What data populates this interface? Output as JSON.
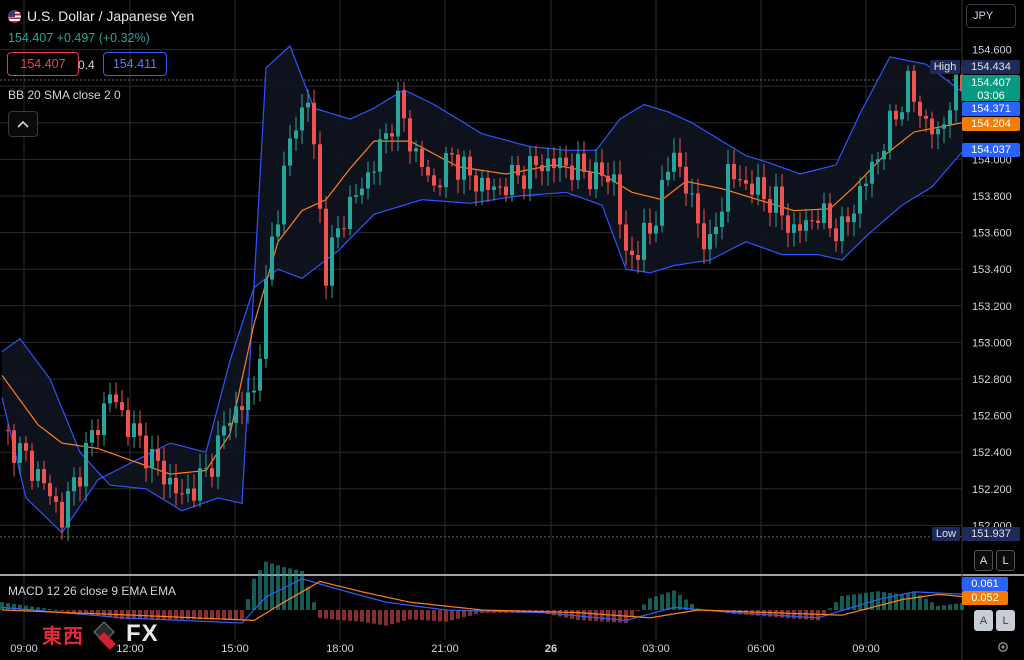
{
  "header": {
    "symbol": "U.S. Dollar / Japanese Yen",
    "change": "154.407 +0.497 (+0.32%)",
    "sell_price": "154.407",
    "spread": "0.4",
    "buy_price": "154.411",
    "indicator_label": "BB 20 SMA close 2 0",
    "collapse_icon": "chevron-up-icon"
  },
  "currency_select": "JPY",
  "axis": {
    "price_ticks": [
      "154.600",
      "154.400",
      "154.200",
      "154.000",
      "153.800",
      "153.600",
      "153.400",
      "153.200",
      "153.000",
      "152.800",
      "152.600",
      "152.400",
      "152.200",
      "152.000"
    ],
    "time_ticks": [
      "09:00",
      "12:00",
      "15:00",
      "18:00",
      "21:00",
      "26",
      "03:00",
      "06:00",
      "09:00"
    ],
    "high_label": "High",
    "high_value": "154.434",
    "low_label": "Low",
    "low_value": "151.937",
    "last_price": "154.407",
    "countdown": "03:06",
    "bb_upper": "154.371",
    "bb_basis": "154.204",
    "bb_lower": "154.037",
    "btn_auto": "A",
    "btn_log": "L"
  },
  "macd": {
    "label": "MACD 12 26 close 9 EMA EMA",
    "macd_value": "0.061",
    "signal_value": "0.052"
  },
  "watermark": {
    "kanji": "東西",
    "fx": "FX"
  },
  "colors": {
    "up": "#26a69a",
    "down": "#ef5350",
    "bb_band": "#2f53ff",
    "bb_basis": "#ff7f1e",
    "high_box": "#1e2a5a",
    "last_price_box": "#089981",
    "upper_box": "#2962ff",
    "basis_box": "#f57c00"
  },
  "chart_data": {
    "type": "candlestick",
    "symbol": "U.S. Dollar / Japanese Yen",
    "close_anchors": [
      [
        0,
        152.52
      ],
      [
        6,
        152.28
      ],
      [
        10,
        152.05
      ],
      [
        14,
        152.4
      ],
      [
        18,
        152.72
      ],
      [
        22,
        152.5
      ],
      [
        26,
        152.32
      ],
      [
        30,
        152.15
      ],
      [
        34,
        152.28
      ],
      [
        38,
        152.6
      ],
      [
        42,
        152.72
      ],
      [
        45,
        153.55
      ],
      [
        48,
        154.1
      ],
      [
        51,
        154.35
      ],
      [
        54,
        153.4
      ],
      [
        57,
        153.7
      ],
      [
        60,
        153.85
      ],
      [
        63,
        154.05
      ],
      [
        66,
        154.3
      ],
      [
        69,
        154.02
      ],
      [
        72,
        153.85
      ],
      [
        75,
        154.02
      ],
      [
        78,
        153.9
      ],
      [
        82,
        153.83
      ],
      [
        86,
        153.91
      ],
      [
        90,
        153.98
      ],
      [
        94,
        153.97
      ],
      [
        98,
        153.92
      ],
      [
        102,
        153.9
      ],
      [
        104,
        153.45
      ],
      [
        108,
        153.6
      ],
      [
        112,
        154.05
      ],
      [
        115,
        153.75
      ],
      [
        118,
        153.5
      ],
      [
        121,
        153.92
      ],
      [
        125,
        153.85
      ],
      [
        129,
        153.76
      ],
      [
        132,
        153.6
      ],
      [
        136,
        153.7
      ],
      [
        140,
        153.6
      ],
      [
        143,
        153.82
      ],
      [
        146,
        154.02
      ],
      [
        149,
        154.25
      ],
      [
        151,
        154.4
      ],
      [
        154,
        154.2
      ],
      [
        156,
        154.12
      ],
      [
        158,
        154.32
      ],
      [
        160,
        154.41
      ]
    ],
    "bb_upper_anchors": [
      [
        0,
        152.95
      ],
      [
        3,
        153.02
      ],
      [
        8,
        152.8
      ],
      [
        13,
        152.4
      ],
      [
        18,
        152.22
      ],
      [
        24,
        152.2
      ],
      [
        30,
        152.08
      ],
      [
        36,
        152.15
      ],
      [
        40,
        152.12
      ],
      [
        44,
        154.5
      ],
      [
        48,
        154.62
      ],
      [
        52,
        154.28
      ],
      [
        58,
        154.22
      ],
      [
        62,
        154.28
      ],
      [
        67,
        154.38
      ],
      [
        72,
        154.3
      ],
      [
        80,
        154.14
      ],
      [
        88,
        154.07
      ],
      [
        94,
        154.05
      ],
      [
        99,
        154.05
      ],
      [
        103,
        154.22
      ],
      [
        107,
        154.3
      ],
      [
        111,
        154.26
      ],
      [
        115,
        154.2
      ],
      [
        119,
        154.12
      ],
      [
        124,
        154.02
      ],
      [
        128,
        153.98
      ],
      [
        133,
        153.92
      ],
      [
        139,
        153.97
      ],
      [
        143,
        154.25
      ],
      [
        148,
        154.56
      ],
      [
        154,
        154.52
      ],
      [
        160,
        154.37
      ]
    ],
    "bb_basis_anchors": [
      [
        0,
        152.82
      ],
      [
        6,
        152.55
      ],
      [
        10,
        152.45
      ],
      [
        16,
        152.42
      ],
      [
        22,
        152.35
      ],
      [
        28,
        152.28
      ],
      [
        34,
        152.3
      ],
      [
        38,
        152.5
      ],
      [
        42,
        153.1
      ],
      [
        46,
        153.55
      ],
      [
        50,
        153.72
      ],
      [
        54,
        153.78
      ],
      [
        58,
        153.95
      ],
      [
        62,
        154.1
      ],
      [
        68,
        154.1
      ],
      [
        76,
        153.96
      ],
      [
        84,
        153.92
      ],
      [
        92,
        153.97
      ],
      [
        100,
        153.92
      ],
      [
        105,
        153.82
      ],
      [
        110,
        153.78
      ],
      [
        114,
        153.88
      ],
      [
        120,
        153.84
      ],
      [
        126,
        153.78
      ],
      [
        132,
        153.72
      ],
      [
        138,
        153.73
      ],
      [
        142,
        153.85
      ],
      [
        147,
        154.02
      ],
      [
        152,
        154.15
      ],
      [
        160,
        154.2
      ]
    ],
    "bb_lower_anchors": [
      [
        0,
        152.7
      ],
      [
        4,
        152.15
      ],
      [
        10,
        151.96
      ],
      [
        16,
        152.25
      ],
      [
        22,
        152.35
      ],
      [
        28,
        152.45
      ],
      [
        34,
        152.4
      ],
      [
        38,
        152.9
      ],
      [
        42,
        153.3
      ],
      [
        46,
        153.4
      ],
      [
        50,
        153.35
      ],
      [
        56,
        153.5
      ],
      [
        62,
        153.7
      ],
      [
        70,
        153.78
      ],
      [
        78,
        153.76
      ],
      [
        86,
        153.8
      ],
      [
        94,
        153.82
      ],
      [
        100,
        153.75
      ],
      [
        104,
        153.4
      ],
      [
        108,
        153.38
      ],
      [
        112,
        153.42
      ],
      [
        118,
        153.45
      ],
      [
        124,
        153.55
      ],
      [
        130,
        153.48
      ],
      [
        136,
        153.48
      ],
      [
        140,
        153.45
      ],
      [
        144,
        153.58
      ],
      [
        150,
        153.75
      ],
      [
        155,
        153.85
      ],
      [
        160,
        154.04
      ]
    ],
    "macd_anchors": [
      [
        0,
        0.01
      ],
      [
        20,
        -0.03
      ],
      [
        40,
        -0.05
      ],
      [
        44,
        0.05
      ],
      [
        50,
        0.12
      ],
      [
        56,
        0.08
      ],
      [
        64,
        0.03
      ],
      [
        74,
        0.0
      ],
      [
        90,
        -0.01
      ],
      [
        104,
        -0.04
      ],
      [
        112,
        0.01
      ],
      [
        122,
        -0.01
      ],
      [
        136,
        -0.03
      ],
      [
        146,
        0.04
      ],
      [
        152,
        0.07
      ],
      [
        160,
        0.061
      ]
    ],
    "signal_anchors": [
      [
        0,
        0.0
      ],
      [
        22,
        -0.02
      ],
      [
        42,
        -0.04
      ],
      [
        47,
        0.03
      ],
      [
        53,
        0.11
      ],
      [
        60,
        0.07
      ],
      [
        68,
        0.03
      ],
      [
        80,
        0.0
      ],
      [
        96,
        -0.01
      ],
      [
        108,
        -0.03
      ],
      [
        116,
        0.0
      ],
      [
        128,
        -0.01
      ],
      [
        140,
        -0.02
      ],
      [
        150,
        0.04
      ],
      [
        156,
        0.06
      ],
      [
        160,
        0.052
      ]
    ]
  }
}
